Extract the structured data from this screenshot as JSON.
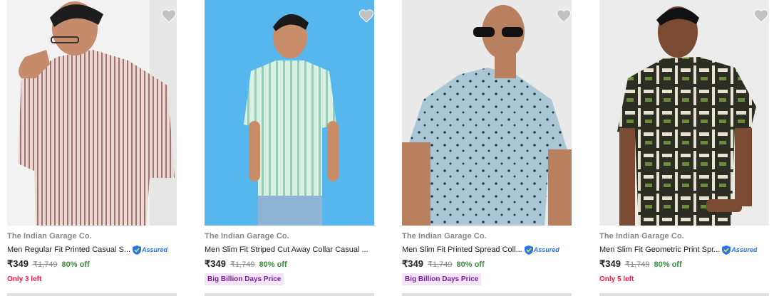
{
  "products": [
    {
      "brand": "The Indian Garage Co.",
      "title": "Men Regular Fit Printed Casual S...",
      "assured": "Assured",
      "price": "₹349",
      "mrp": "₹1,749",
      "discount": "80% off",
      "note": "Only 3 left",
      "note_style": "red",
      "bg": "#f2f2f2",
      "shirt": "#d7bfbd"
    },
    {
      "brand": "The Indian Garage Co.",
      "title": "Men Slim Fit Striped Cut Away Collar Casual ...",
      "assured": "",
      "price": "₹349",
      "mrp": "₹1,749",
      "discount": "80% off",
      "note": "Big Billion Days Price",
      "note_style": "purple",
      "bg": "#56b7ef",
      "shirt": "#bfe6d4"
    },
    {
      "brand": "The Indian Garage Co.",
      "title": "Men Slim Fit Printed Spread Coll...",
      "assured": "Assured",
      "price": "₹349",
      "mrp": "₹1,749",
      "discount": "80% off",
      "note": "Big Billion Days Price",
      "note_style": "purple",
      "bg": "#e9e9e9",
      "shirt": "#a9c7d6"
    },
    {
      "brand": "The Indian Garage Co.",
      "title": "Men Slim Fit Geometric Print Spr...",
      "assured": "Assured",
      "price": "₹349",
      "mrp": "₹1,749",
      "discount": "80% off",
      "note": "Only 5 left",
      "note_style": "red",
      "bg": "#ececec",
      "shirt": "#2c2e24"
    }
  ]
}
